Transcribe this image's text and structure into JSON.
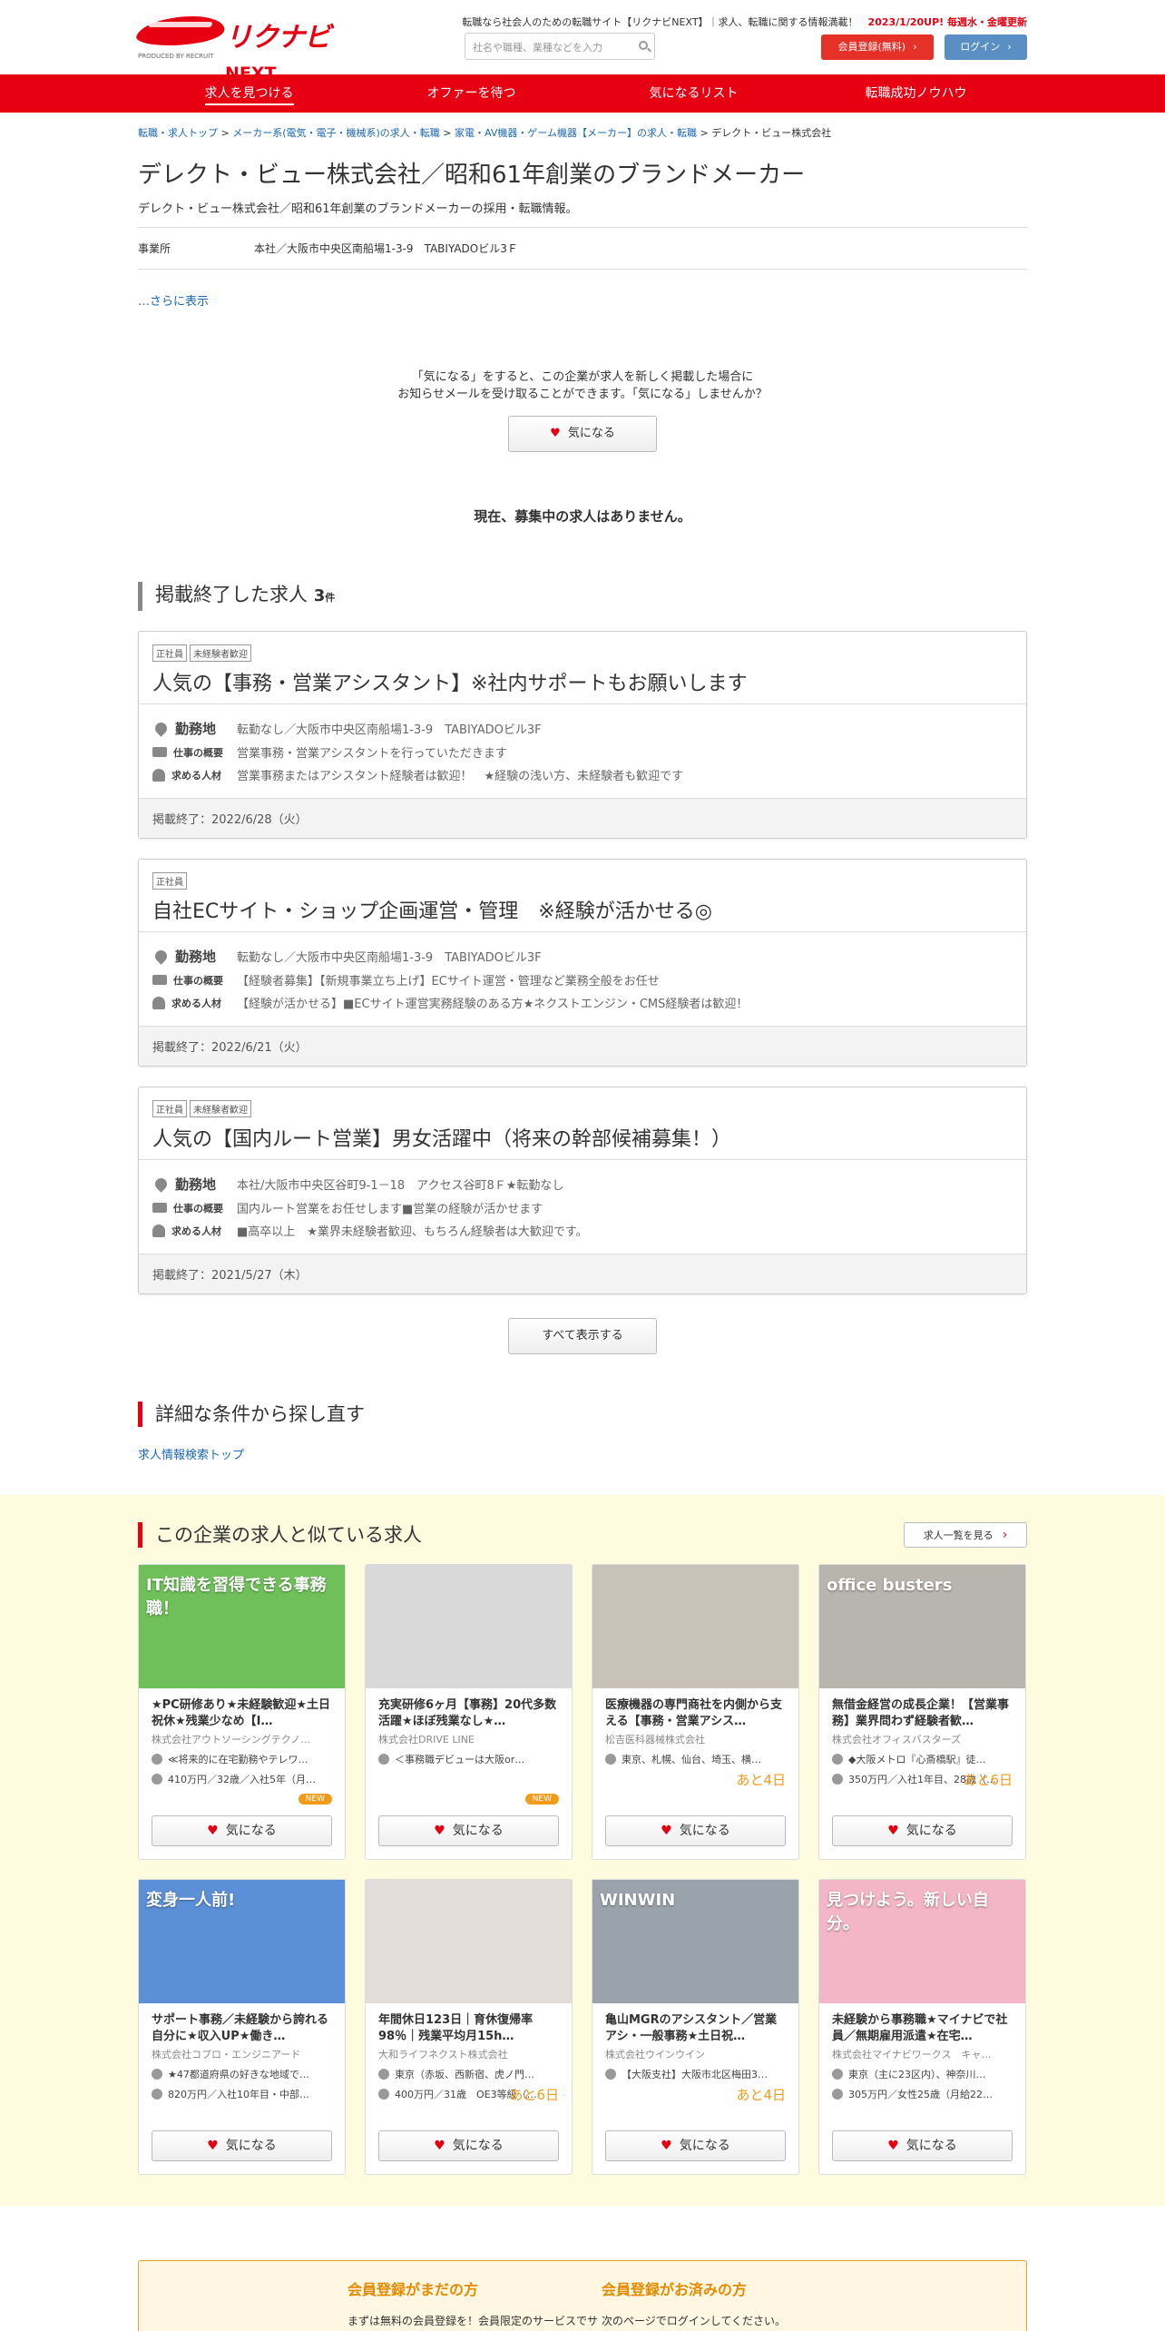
{
  "header": {
    "brand": "リクナビ",
    "brand_small": "NEXT",
    "produced_by": "PRODUCED BY RECRUIT",
    "tagline": "転職なら社会人のための転職サイト【リクナビNEXT】｜求人、転職に関する情報満載！",
    "update_note": "2023/1/20UP! 毎週水・金曜更新",
    "search_placeholder": "社名や職種、業種などを入力",
    "register_label": "会員登録(無料)",
    "login_label": "ログイン"
  },
  "nav": [
    "求人を見つける",
    "オファーを待つ",
    "気になるリスト",
    "転職成功ノウハウ"
  ],
  "breadcrumb": {
    "items": [
      "転職・求人トップ",
      "メーカー系(電気・電子・機械系)の求人・転職",
      "家電・AV機器・ゲーム機器【メーカー】の求人・転職"
    ],
    "current": "デレクト・ビュー株式会社"
  },
  "company": {
    "title": "デレクト・ビュー株式会社／昭和61年創業のブランドメーカー",
    "subtitle": "デレクト・ビュー株式会社／昭和61年創業のブランドメーカーの採用・転職情報。",
    "office_label": "事業所",
    "office_value": "本社／大阪市中央区南船場1-3-9　TABIYADOビル3Ｆ",
    "more": "…さらに表示"
  },
  "favorite": {
    "note_line1": "「気になる」をすると、この企業が求人を新しく掲載した場合に",
    "note_line2": "お知らせメールを受け取ることができます。「気になる」しませんか？",
    "button": "気になる"
  },
  "no_jobs": "現在、募集中の求人はありません。",
  "ended": {
    "heading": "掲載終了した求人",
    "count": "3",
    "count_unit": "件",
    "label_location": "勤務地",
    "label_summary": "仕事の概要",
    "label_requirement": "求める人材",
    "jobs": [
      {
        "tags": [
          "正社員",
          "未経験者歓迎"
        ],
        "title": "人気の【事務・営業アシスタント】※社内サポートもお願いします",
        "location": "転勤なし／大阪市中央区南船場1-3-9　TABIYADOビル3F",
        "summary": "営業事務・営業アシスタントを行っていただきます",
        "requirement": "営業事務またはアシスタント経験者は歓迎！　★経験の浅い方、未経験者も歓迎です",
        "ended": "掲載終了：2022/6/28（火）"
      },
      {
        "tags": [
          "正社員"
        ],
        "title": "自社ECサイト・ショップ企画運営・管理　※経験が活かせる◎",
        "location": "転勤なし／大阪市中央区南船場1-3-9　TABIYADOビル3F",
        "summary": "【経験者募集】【新規事業立ち上げ】ECサイト運営・管理など業務全般をお任せ",
        "requirement": "【経験が活かせる】■ECサイト運営実務経験のある方★ネクストエンジン・CMS経験者は歓迎！",
        "ended": "掲載終了：2022/6/21（火）"
      },
      {
        "tags": [
          "正社員",
          "未経験者歓迎"
        ],
        "title": "人気の【国内ルート営業】男女活躍中（将来の幹部候補募集！）",
        "location": "本社/大阪市中央区谷町9-1－18　アクセス谷町8Ｆ★転勤なし",
        "summary": "国内ルート営業をお任せします■営業の経験が活かせます",
        "requirement": "■高卒以上　★業界未経験者歓迎、もちろん経験者は大歓迎です。",
        "ended": "掲載終了：2021/5/27（木）"
      }
    ],
    "show_all": "すべて表示する"
  },
  "refine": {
    "heading": "詳細な条件から探し直す",
    "link": "求人情報検索トップ"
  },
  "similar": {
    "heading": "この企業の求人と似ている求人",
    "list_button": "求人一覧を見る",
    "fav_label": "気になる",
    "cards": [
      {
        "title": "★PC研修あり★未経験歓迎★土日祝休★残業少なめ【I…",
        "company": "株式会社アウトソーシングテクノ…",
        "loc": "≪将来的に在宅勤務やテレワ…",
        "salary": "410万円／32歳／入社5年（月…",
        "badge": "NEW",
        "days": "",
        "img_text": "IT知識を習得できる事務職！",
        "img_color": "#6fc05a"
      },
      {
        "title": "充実研修6ヶ月【事務】20代多数活躍★ほぼ残業なし★…",
        "company": "株式会社DRIVE LINE",
        "loc": "＜事務職デビューは大阪or…",
        "salary": "",
        "badge": "NEW",
        "days": "",
        "img_text": "",
        "img_color": "#d9d9d9"
      },
      {
        "title": "医療機器の専門商社を内側から支える【事務・営業アシス…",
        "company": "松吉医科器械株式会社",
        "loc": "東京、札幌、仙台、埼玉、横…",
        "salary": "",
        "badge": "",
        "days": "あと4日",
        "img_text": "",
        "img_color": "#c9c2b8"
      },
      {
        "title": "無借金経営の成長企業！【営業事務】業界問わず経験者歓…",
        "company": "株式会社オフィスバスターズ",
        "loc": "◆大阪メトロ『心斎橋駅』徒…",
        "salary": "350万円／入社1年目、28歳（…",
        "badge": "",
        "days": "あと6日",
        "img_text": "office busters",
        "img_color": "#b8b4ae"
      },
      {
        "title": "サポート事務／未経験から誇れる自分に★収入UP★働き…",
        "company": "株式会社コプロ・エンジニアード",
        "loc": "★47都道府県の好きな地域で…",
        "salary": "820万円／入社10年目・中部…",
        "badge": "",
        "days": "",
        "img_text": "変身一人前!",
        "img_color": "#5b8fd6"
      },
      {
        "title": "年間休日123日｜育休復帰率98％｜残業平均月15h…",
        "company": "大和ライフネクスト株式会社",
        "loc": "東京（赤坂、西新宿、虎ノ門…",
        "salary": "400万円／31歳　OE3等級（…",
        "badge": "",
        "days": "あと6日",
        "img_text": "",
        "img_color": "#e2ddd8"
      },
      {
        "title": "亀山MGRのアシスタント／営業アシ・一般事務★土日祝…",
        "company": "株式会社ウインウイン",
        "loc": "【大阪支社】大阪市北区梅田3…",
        "salary": "",
        "badge": "",
        "days": "あと4日",
        "img_text": "WINWIN",
        "img_color": "#9aa3ab"
      },
      {
        "title": "未経験から事務職★マイナビで社員／無期雇用派遣★在宅…",
        "company": "株式会社マイナビワークス　キャ…",
        "loc": "東京（主に23区内）、神奈川…",
        "salary": "305万円／女性25歳（月給22…",
        "badge": "",
        "days": "",
        "img_text": "見つけよう。新しい自分。",
        "img_color": "#f3b6c7"
      }
    ]
  },
  "register": {
    "new_title": "会員登録がまだの方",
    "new_text": "まずは無料の会員登録を！会員限定のサービスでサポートします。",
    "member_title": "会員登録がお済みの方",
    "member_text": "次のページでログインしてください。"
  }
}
